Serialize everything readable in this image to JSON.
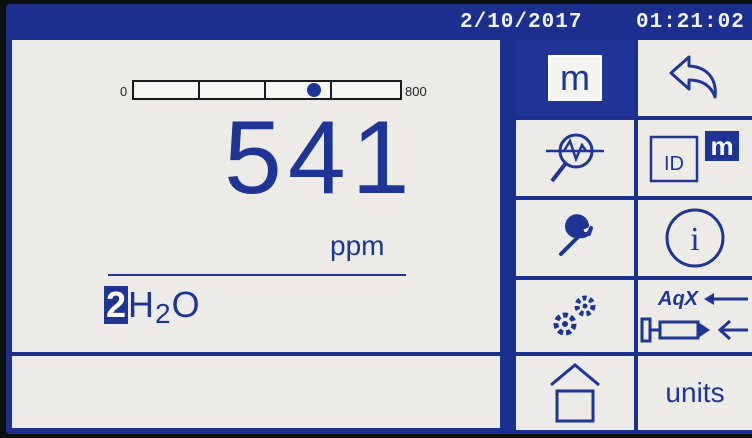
{
  "status": {
    "date": "2/10/2017",
    "time": "01:21:02"
  },
  "display": {
    "range_min": "0",
    "range_max": "800",
    "gauge_level_fraction": 0.676,
    "value": "541",
    "unit": "ppm",
    "channel": {
      "number": "2",
      "part1": "H",
      "sub": "2",
      "part2": "O"
    }
  },
  "menu": {
    "m_label": "m",
    "id_label": "ID",
    "id_badge": "m",
    "info_label": "i",
    "aqx_label": "AqX",
    "units_label": "units"
  },
  "colors": {
    "accent": "#1e3596",
    "frame": "#1a2f8e",
    "panel": "#ecebe7"
  },
  "icons": [
    "m-menu-icon",
    "back-arrow-icon",
    "trend-magnifier-icon",
    "id-m-icon",
    "wrench-icon",
    "info-icon",
    "gears-icon",
    "aqx-syringe-icon",
    "home-icon"
  ]
}
